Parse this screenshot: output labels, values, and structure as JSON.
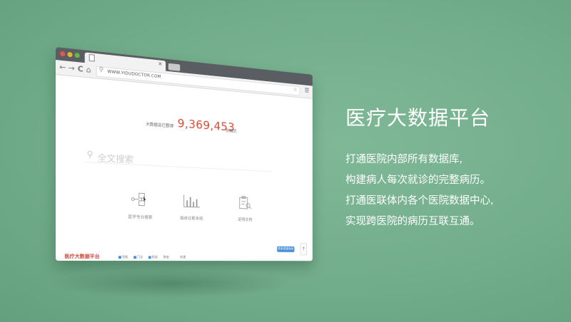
{
  "browser": {
    "url": "WWW.YIDUDOCTOR.COM",
    "stat_label": "大数据总已整理",
    "stat_value": "9,369,453",
    "stat_unit": "份病历",
    "search_placeholder": "全文搜索",
    "features": [
      {
        "label": "医学专业搜索",
        "icon": "flowchart-icon"
      },
      {
        "label": "临床诊断系统",
        "icon": "bar-chart-icon"
      },
      {
        "label": "说明文档",
        "icon": "document-icon"
      }
    ],
    "help_button": "联系客服询问",
    "logo_text": "医疗大数据平台",
    "footer_items": [
      "导航",
      "门诊",
      "检验",
      "其他",
      "科室"
    ]
  },
  "promo": {
    "title": "医疗大数据平台",
    "lines": [
      "打通医院内部所有数据库,",
      "构建病人每次就诊的完整病历。",
      "打通医联体内各个医院数据中心,",
      "实现跨医院的病历互联互通。"
    ]
  }
}
